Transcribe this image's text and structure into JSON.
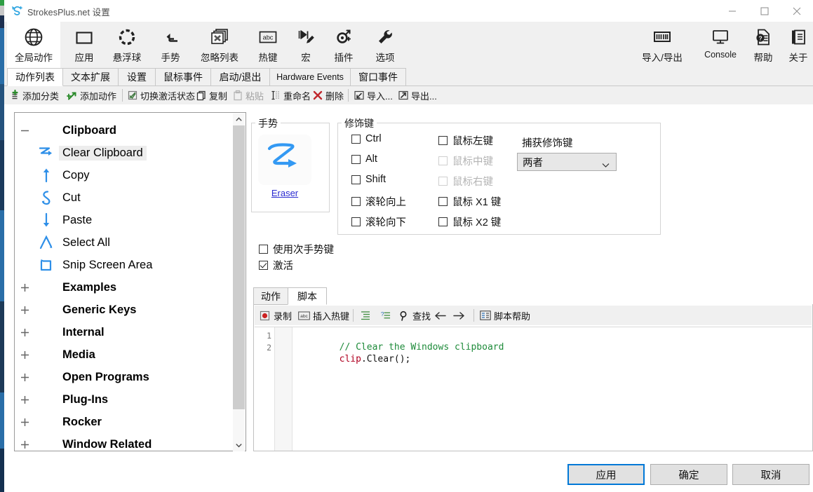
{
  "window": {
    "title": "StrokesPlus.net 设置",
    "app_icon": "strokesplus-logo-icon",
    "minimize": "−",
    "maximize": "□",
    "close": "✕"
  },
  "ribbon": {
    "items": [
      {
        "label": "全局动作",
        "icon": "globe-icon",
        "selected": true
      },
      {
        "label": "应用",
        "icon": "window-icon",
        "selected": false
      },
      {
        "label": "悬浮球",
        "icon": "dashed-circle-icon",
        "selected": false
      },
      {
        "label": "手势",
        "icon": "gesture-arrow-icon",
        "selected": false
      },
      {
        "label": "忽略列表",
        "icon": "stacked-windows-x-icon",
        "selected": false
      },
      {
        "label": "热键",
        "icon": "abc-key-icon",
        "selected": false
      },
      {
        "label": "宏",
        "icon": "macro-play-pencil-icon",
        "selected": false
      },
      {
        "label": "插件",
        "icon": "plugin-node-icon",
        "selected": false
      },
      {
        "label": "选项",
        "icon": "wrench-icon",
        "selected": false
      }
    ],
    "right_items": [
      {
        "label": "导入/导出",
        "icon": "import-export-barcode-icon"
      },
      {
        "label": "Console",
        "icon": "monitor-icon"
      },
      {
        "label": "帮助",
        "icon": "help-document-icon"
      },
      {
        "label": "关于",
        "icon": "about-scroll-icon"
      }
    ]
  },
  "tabs": {
    "items": [
      {
        "label": "动作列表",
        "active": true
      },
      {
        "label": "文本扩展",
        "active": false
      },
      {
        "label": "设置",
        "active": false
      },
      {
        "label": "鼠标事件",
        "active": false
      },
      {
        "label": "启动/退出",
        "active": false
      },
      {
        "label": "Hardware Events",
        "active": false
      },
      {
        "label": "窗口事件",
        "active": false
      }
    ]
  },
  "action_toolbar": {
    "items": [
      {
        "label": "添加分类",
        "icon": "add-category-icon",
        "disabled": false
      },
      {
        "label": "添加动作",
        "icon": "add-action-arrow-icon",
        "disabled": false
      },
      {
        "label": "切换激活状态",
        "icon": "toggle-enabled-icon",
        "disabled": false
      },
      {
        "label": "复制",
        "icon": "copy-icon",
        "disabled": false
      },
      {
        "label": "粘贴",
        "icon": "paste-icon",
        "disabled": true
      },
      {
        "label": "重命名",
        "icon": "rename-cursor-icon",
        "disabled": false
      },
      {
        "label": "删除",
        "icon": "delete-x-icon",
        "disabled": false
      },
      {
        "label": "导入...",
        "icon": "import-arrow-icon",
        "disabled": false
      },
      {
        "label": "导出...",
        "icon": "export-arrow-icon",
        "disabled": false
      }
    ]
  },
  "tree": {
    "nodes": [
      {
        "label": "Clipboard",
        "type": "category",
        "expander": "minus",
        "selected": false,
        "icon": null
      },
      {
        "label": "Clear Clipboard",
        "type": "action",
        "expander": null,
        "selected": true,
        "icon": "gesture-zigzag-icon"
      },
      {
        "label": "Copy",
        "type": "action",
        "expander": null,
        "selected": false,
        "icon": "gesture-up-icon"
      },
      {
        "label": "Cut",
        "type": "action",
        "expander": null,
        "selected": false,
        "icon": "gesture-loop-icon"
      },
      {
        "label": "Paste",
        "type": "action",
        "expander": null,
        "selected": false,
        "icon": "gesture-down-icon"
      },
      {
        "label": "Select All",
        "type": "action",
        "expander": null,
        "selected": false,
        "icon": "gesture-caret-icon"
      },
      {
        "label": "Snip Screen Area",
        "type": "action",
        "expander": null,
        "selected": false,
        "icon": "gesture-square-icon"
      },
      {
        "label": "Examples",
        "type": "category",
        "expander": "plus",
        "selected": false,
        "icon": null
      },
      {
        "label": "Generic Keys",
        "type": "category",
        "expander": "plus",
        "selected": false,
        "icon": null
      },
      {
        "label": "Internal",
        "type": "category",
        "expander": "plus",
        "selected": false,
        "icon": null
      },
      {
        "label": "Media",
        "type": "category",
        "expander": "plus",
        "selected": false,
        "icon": null
      },
      {
        "label": "Open Programs",
        "type": "category",
        "expander": "plus",
        "selected": false,
        "icon": null
      },
      {
        "label": "Plug-Ins",
        "type": "category",
        "expander": "plus",
        "selected": false,
        "icon": null
      },
      {
        "label": "Rocker",
        "type": "category",
        "expander": "plus",
        "selected": false,
        "icon": null
      },
      {
        "label": "Window Related",
        "type": "category",
        "expander": "plus",
        "selected": false,
        "icon": null
      }
    ],
    "scrollbar": {
      "up": "▲",
      "down": "▼"
    }
  },
  "gesture_group": {
    "title": "手势",
    "thumbnail_icon": "gesture-zigzag-stroke",
    "link_label": "Eraser"
  },
  "modifier_group": {
    "title": "修饰键",
    "column1": [
      {
        "label": "Ctrl",
        "checked": false,
        "disabled": false
      },
      {
        "label": "Alt",
        "checked": false,
        "disabled": false
      },
      {
        "label": "Shift",
        "checked": false,
        "disabled": false
      },
      {
        "label": "滚轮向上",
        "checked": false,
        "disabled": false
      },
      {
        "label": "滚轮向下",
        "checked": false,
        "disabled": false
      }
    ],
    "column2": [
      {
        "label": "鼠标左键",
        "checked": false,
        "disabled": false
      },
      {
        "label": "鼠标中键",
        "checked": false,
        "disabled": true
      },
      {
        "label": "鼠标右键",
        "checked": false,
        "disabled": true
      },
      {
        "label": "鼠标 X1 键",
        "checked": false,
        "disabled": false
      },
      {
        "label": "鼠标 X2 键",
        "checked": false,
        "disabled": false
      }
    ],
    "capture_label": "捕获修饰键",
    "capture_value": "两者"
  },
  "options": [
    {
      "label": "使用次手势键",
      "checked": false
    },
    {
      "label": "激活",
      "checked": true
    }
  ],
  "script_panel": {
    "tabs": [
      {
        "label": "动作",
        "active": false
      },
      {
        "label": "脚本",
        "active": true
      }
    ],
    "toolbar": [
      {
        "label": "录制",
        "icon": "record-icon"
      },
      {
        "label": "插入热键",
        "icon": "abc-key-icon"
      },
      {
        "label": "",
        "icon": "indent-icon"
      },
      {
        "label": "",
        "icon": "comment-icon"
      },
      {
        "label": "查找",
        "icon": "magnifier-icon"
      },
      {
        "label": "",
        "icon": "arrow-left-icon"
      },
      {
        "label": "",
        "icon": "arrow-right-icon"
      },
      {
        "label": "脚本帮助",
        "icon": "script-help-icon"
      }
    ],
    "editor": {
      "lines": [
        {
          "number": "1",
          "tokens": [
            {
              "text": "// Clear the Windows clipboard",
              "cls": "k-com"
            }
          ]
        },
        {
          "number": "2",
          "tokens": [
            {
              "text": "clip",
              "cls": "k-id"
            },
            {
              "text": ".Clear();",
              "cls": "k-pl"
            }
          ]
        }
      ]
    }
  },
  "footer": {
    "apply": "应用",
    "ok": "确定",
    "cancel": "取消"
  },
  "colors": {
    "accent": "#0078d7",
    "gesture_blue": "#3399f3",
    "link": "#2a2ad0",
    "comment_green": "#1e8b3a",
    "identifier_red": "#b00020"
  }
}
